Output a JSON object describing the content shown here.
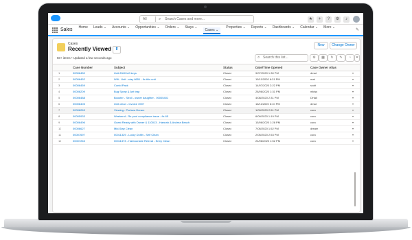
{
  "header": {
    "search_scope": "All",
    "search_placeholder": "Search Cases and more..."
  },
  "nav": {
    "app_name": "Sales",
    "items": [
      {
        "label": "Home",
        "active": false
      },
      {
        "label": "Leads ⌄",
        "active": false
      },
      {
        "label": "Accounts ⌄",
        "active": false
      },
      {
        "label": "Opportunities ⌄",
        "active": false
      },
      {
        "label": "Orders ⌄",
        "active": false
      },
      {
        "label": "Stays ⌄",
        "active": false
      },
      {
        "label": "Cases ⌄",
        "active": true
      },
      {
        "label": "Properties ⌄",
        "active": false
      },
      {
        "label": "Reports ⌄",
        "active": false
      },
      {
        "label": "Dashboards ⌄",
        "active": false
      },
      {
        "label": "Calendar ⌄",
        "active": false
      },
      {
        "label": "More ⌄",
        "active": false
      }
    ]
  },
  "list": {
    "object_label": "Cases",
    "view_name": "Recently Viewed",
    "meta": "50+ items • Updated a few seconds ago",
    "search_placeholder": "Search this list...",
    "buttons": {
      "new": "New",
      "change_owner": "Change Owner"
    },
    "columns": [
      "Case Number",
      "Subject",
      "Status",
      "Date/Time Opened",
      "Case Owner Alias"
    ],
    "rows": [
      {
        "n": "1",
        "case": "00006450",
        "subject": "Unit 8340 left keys",
        "status": "Closed",
        "opened": "9/07/2020 1:30 PM",
        "owner": "dmat"
      },
      {
        "n": "2",
        "case": "00006452",
        "subject": "Wifi - Unit - stay 6651 - fix this unit",
        "status": "Closed",
        "opened": "15/11/2020 6:31 PM",
        "owner": "mat"
      },
      {
        "n": "3",
        "case": "00006459",
        "subject": "Contd Pack",
        "status": "Closed",
        "opened": "14/07/2020 2:22 PM",
        "owner": "scott"
      },
      {
        "n": "4",
        "case": "00006209",
        "subject": "Bug Spray & Ant trap",
        "status": "Closed",
        "opened": "28/06/2020 1:31 PM",
        "owner": "mkiss"
      },
      {
        "n": "5",
        "case": "00006488",
        "subject": "Booster - Stroll - owner daughter - 00005401",
        "status": "Closed",
        "opened": "4/08/2020 2:31 PM",
        "owner": "DHall"
      },
      {
        "n": "6",
        "case": "00006405",
        "subject": "Unit clean - Invoice 3907",
        "status": "Closed",
        "opened": "16/11/2020 6:10 PM",
        "owner": "dmat"
      },
      {
        "n": "7",
        "case": "00006263",
        "subject": "Viewing - Portsea Dream",
        "status": "Closed",
        "opened": "1/09/2020 2:51 PM",
        "owner": "conc"
      },
      {
        "n": "8",
        "case": "00005933",
        "subject": "Weekend - Re pool compliance issue - fix 65",
        "status": "Closed",
        "opened": "6/09/2020 1:19 PM",
        "owner": "conc"
      },
      {
        "n": "9",
        "case": "00006496",
        "subject": "Guest Ready with Owner & 110013 - Hannah & Andrea Beach",
        "status": "Closed",
        "opened": "15/06/2020 1:28 PM",
        "owner": "conc"
      },
      {
        "n": "10",
        "case": "00006627",
        "subject": "Mid-Stay Clean",
        "status": "Closed",
        "opened": "7/05/2020 1:52 PM",
        "owner": "dream"
      },
      {
        "n": "11",
        "case": "00007697",
        "subject": "00011329 - Lucky Dolfin - Self Clean",
        "status": "Closed",
        "opened": "2/05/2020 2:53 PM",
        "owner": "conc"
      },
      {
        "n": "12",
        "case": "00007263",
        "subject": "00011373 - Harbourside Retreat - Entry Clean",
        "status": "Closed",
        "opened": "24/06/2020 1:52 PM",
        "owner": "conc"
      }
    ]
  }
}
